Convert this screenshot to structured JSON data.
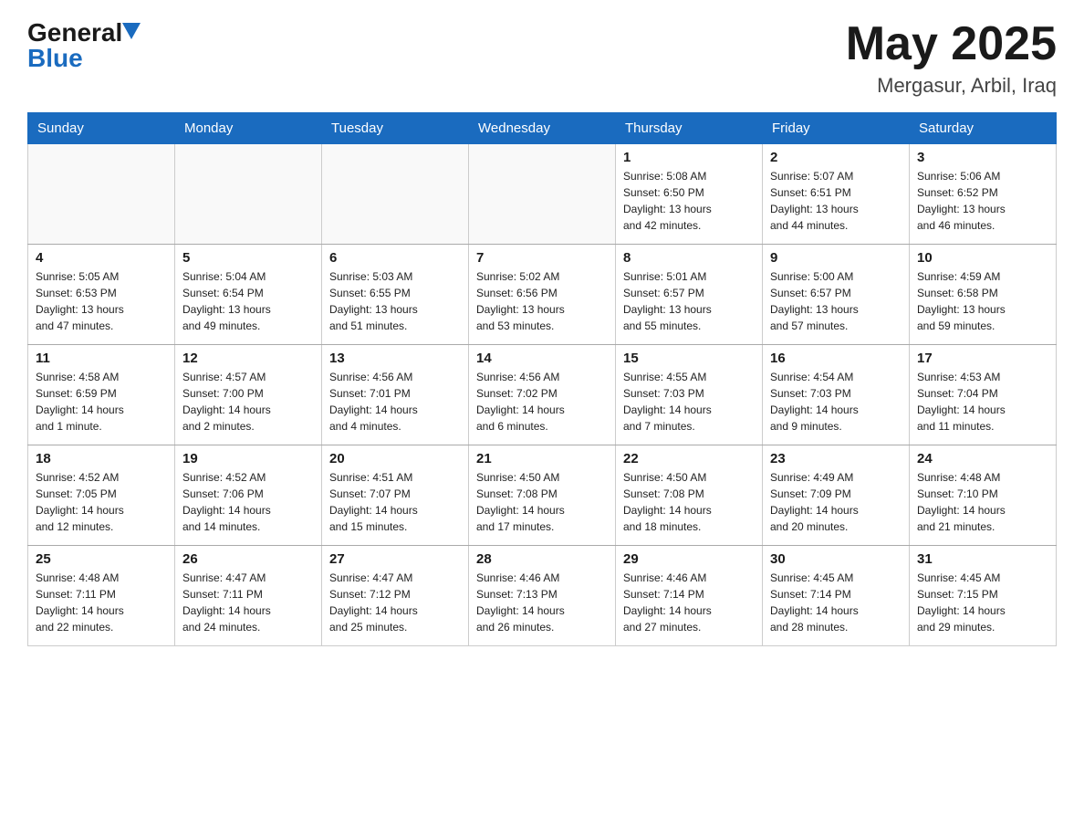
{
  "header": {
    "logo_general": "General",
    "logo_blue": "Blue",
    "title": "May 2025",
    "location": "Mergasur, Arbil, Iraq"
  },
  "weekdays": [
    "Sunday",
    "Monday",
    "Tuesday",
    "Wednesday",
    "Thursday",
    "Friday",
    "Saturday"
  ],
  "weeks": [
    [
      {
        "day": "",
        "info": ""
      },
      {
        "day": "",
        "info": ""
      },
      {
        "day": "",
        "info": ""
      },
      {
        "day": "",
        "info": ""
      },
      {
        "day": "1",
        "info": "Sunrise: 5:08 AM\nSunset: 6:50 PM\nDaylight: 13 hours\nand 42 minutes."
      },
      {
        "day": "2",
        "info": "Sunrise: 5:07 AM\nSunset: 6:51 PM\nDaylight: 13 hours\nand 44 minutes."
      },
      {
        "day": "3",
        "info": "Sunrise: 5:06 AM\nSunset: 6:52 PM\nDaylight: 13 hours\nand 46 minutes."
      }
    ],
    [
      {
        "day": "4",
        "info": "Sunrise: 5:05 AM\nSunset: 6:53 PM\nDaylight: 13 hours\nand 47 minutes."
      },
      {
        "day": "5",
        "info": "Sunrise: 5:04 AM\nSunset: 6:54 PM\nDaylight: 13 hours\nand 49 minutes."
      },
      {
        "day": "6",
        "info": "Sunrise: 5:03 AM\nSunset: 6:55 PM\nDaylight: 13 hours\nand 51 minutes."
      },
      {
        "day": "7",
        "info": "Sunrise: 5:02 AM\nSunset: 6:56 PM\nDaylight: 13 hours\nand 53 minutes."
      },
      {
        "day": "8",
        "info": "Sunrise: 5:01 AM\nSunset: 6:57 PM\nDaylight: 13 hours\nand 55 minutes."
      },
      {
        "day": "9",
        "info": "Sunrise: 5:00 AM\nSunset: 6:57 PM\nDaylight: 13 hours\nand 57 minutes."
      },
      {
        "day": "10",
        "info": "Sunrise: 4:59 AM\nSunset: 6:58 PM\nDaylight: 13 hours\nand 59 minutes."
      }
    ],
    [
      {
        "day": "11",
        "info": "Sunrise: 4:58 AM\nSunset: 6:59 PM\nDaylight: 14 hours\nand 1 minute."
      },
      {
        "day": "12",
        "info": "Sunrise: 4:57 AM\nSunset: 7:00 PM\nDaylight: 14 hours\nand 2 minutes."
      },
      {
        "day": "13",
        "info": "Sunrise: 4:56 AM\nSunset: 7:01 PM\nDaylight: 14 hours\nand 4 minutes."
      },
      {
        "day": "14",
        "info": "Sunrise: 4:56 AM\nSunset: 7:02 PM\nDaylight: 14 hours\nand 6 minutes."
      },
      {
        "day": "15",
        "info": "Sunrise: 4:55 AM\nSunset: 7:03 PM\nDaylight: 14 hours\nand 7 minutes."
      },
      {
        "day": "16",
        "info": "Sunrise: 4:54 AM\nSunset: 7:03 PM\nDaylight: 14 hours\nand 9 minutes."
      },
      {
        "day": "17",
        "info": "Sunrise: 4:53 AM\nSunset: 7:04 PM\nDaylight: 14 hours\nand 11 minutes."
      }
    ],
    [
      {
        "day": "18",
        "info": "Sunrise: 4:52 AM\nSunset: 7:05 PM\nDaylight: 14 hours\nand 12 minutes."
      },
      {
        "day": "19",
        "info": "Sunrise: 4:52 AM\nSunset: 7:06 PM\nDaylight: 14 hours\nand 14 minutes."
      },
      {
        "day": "20",
        "info": "Sunrise: 4:51 AM\nSunset: 7:07 PM\nDaylight: 14 hours\nand 15 minutes."
      },
      {
        "day": "21",
        "info": "Sunrise: 4:50 AM\nSunset: 7:08 PM\nDaylight: 14 hours\nand 17 minutes."
      },
      {
        "day": "22",
        "info": "Sunrise: 4:50 AM\nSunset: 7:08 PM\nDaylight: 14 hours\nand 18 minutes."
      },
      {
        "day": "23",
        "info": "Sunrise: 4:49 AM\nSunset: 7:09 PM\nDaylight: 14 hours\nand 20 minutes."
      },
      {
        "day": "24",
        "info": "Sunrise: 4:48 AM\nSunset: 7:10 PM\nDaylight: 14 hours\nand 21 minutes."
      }
    ],
    [
      {
        "day": "25",
        "info": "Sunrise: 4:48 AM\nSunset: 7:11 PM\nDaylight: 14 hours\nand 22 minutes."
      },
      {
        "day": "26",
        "info": "Sunrise: 4:47 AM\nSunset: 7:11 PM\nDaylight: 14 hours\nand 24 minutes."
      },
      {
        "day": "27",
        "info": "Sunrise: 4:47 AM\nSunset: 7:12 PM\nDaylight: 14 hours\nand 25 minutes."
      },
      {
        "day": "28",
        "info": "Sunrise: 4:46 AM\nSunset: 7:13 PM\nDaylight: 14 hours\nand 26 minutes."
      },
      {
        "day": "29",
        "info": "Sunrise: 4:46 AM\nSunset: 7:14 PM\nDaylight: 14 hours\nand 27 minutes."
      },
      {
        "day": "30",
        "info": "Sunrise: 4:45 AM\nSunset: 7:14 PM\nDaylight: 14 hours\nand 28 minutes."
      },
      {
        "day": "31",
        "info": "Sunrise: 4:45 AM\nSunset: 7:15 PM\nDaylight: 14 hours\nand 29 minutes."
      }
    ]
  ]
}
